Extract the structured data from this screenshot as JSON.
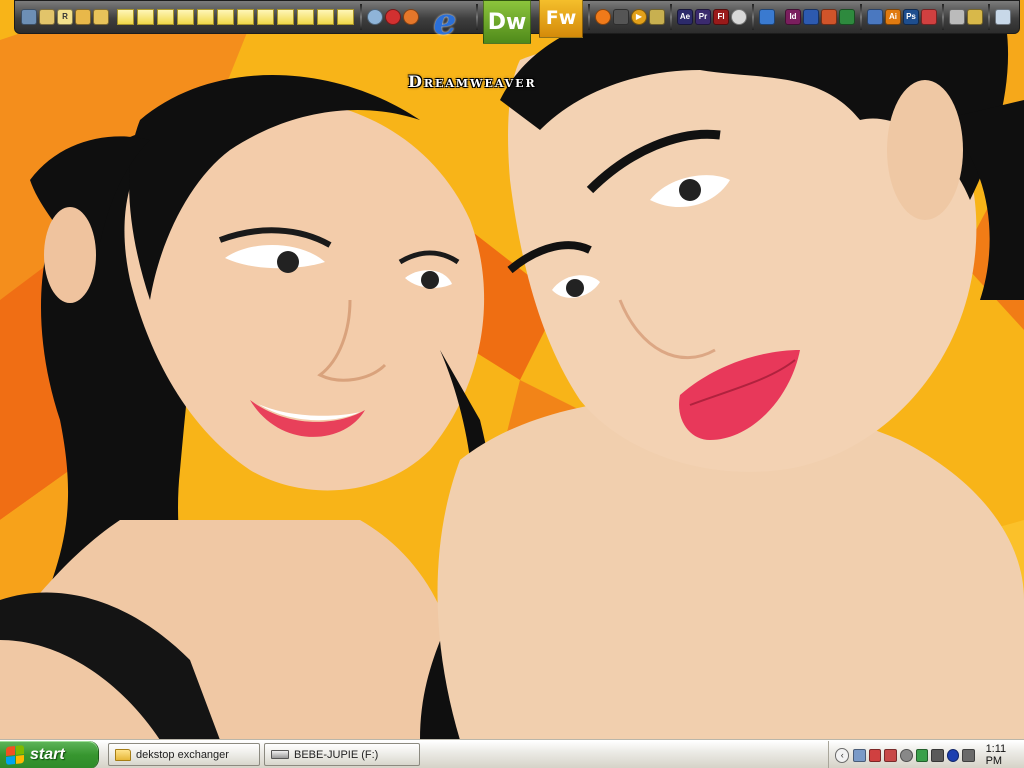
{
  "desktop": {
    "dock_label": "Dreamweaver",
    "big_icons": [
      {
        "name": "dreamweaver-icon",
        "text": "Dw",
        "color": "#6aab2a"
      },
      {
        "name": "fireworks-icon",
        "text": "Fw",
        "color": "#e9a616"
      },
      {
        "name": "internet-explorer-icon",
        "text": "e",
        "color": "#2a6fd8"
      }
    ],
    "dock_small_icons": [
      {
        "name": "after-effects-icon",
        "text": "Ae",
        "color": "#2c2a6a"
      },
      {
        "name": "premiere-icon",
        "text": "Pr",
        "color": "#3b2a6e"
      },
      {
        "name": "flash-icon",
        "text": "Fl",
        "color": "#9a1a1a"
      },
      {
        "name": "indesign-icon",
        "text": "Id",
        "color": "#7a1e5e"
      },
      {
        "name": "illustrator-icon",
        "text": "Ai",
        "color": "#e07a10"
      },
      {
        "name": "photoshop-icon",
        "text": "Ps",
        "color": "#1e4e8e"
      }
    ]
  },
  "taskbar": {
    "start_label": "start",
    "tasks": [
      {
        "label": "dekstop exchanger"
      },
      {
        "label": "BEBE-JUPIE (F:)"
      }
    ],
    "clock": "1:11 PM"
  }
}
